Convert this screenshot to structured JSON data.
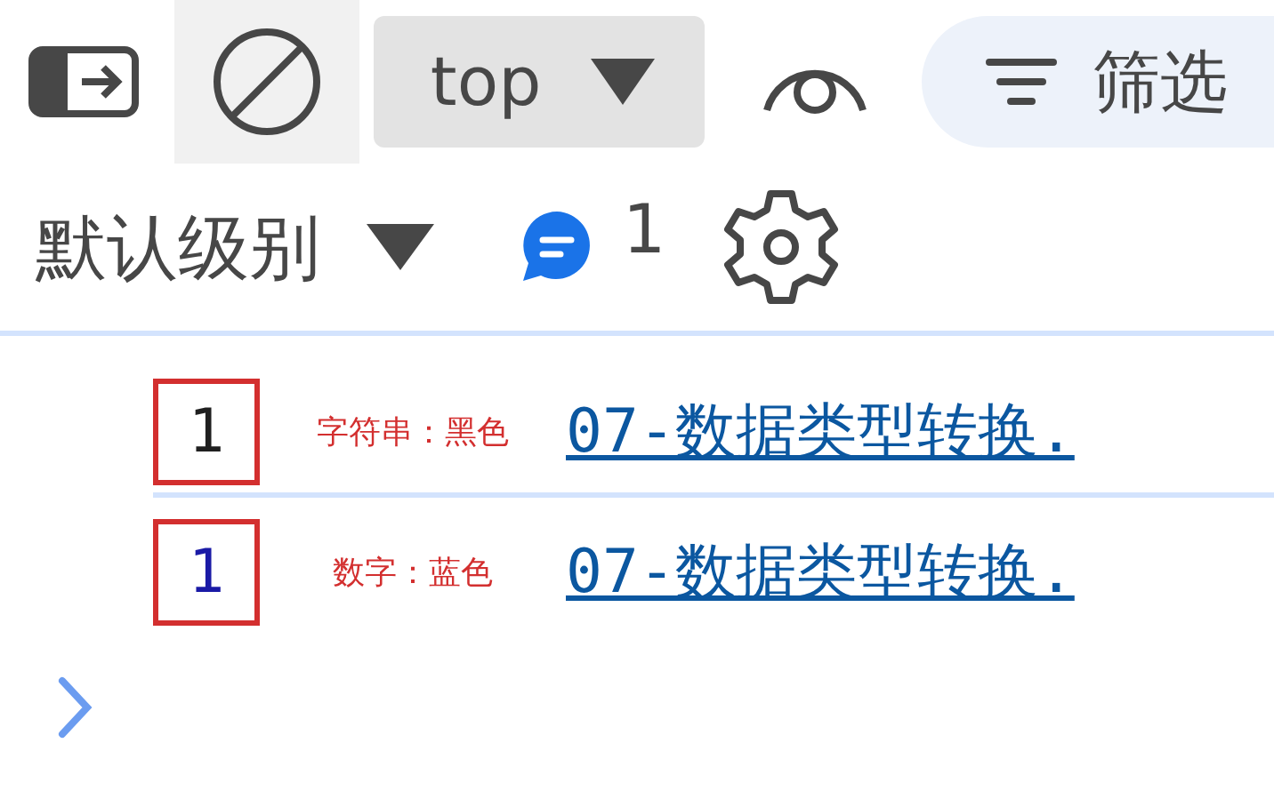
{
  "toolbar": {
    "context": "top",
    "filter_placeholder": "筛选",
    "levels": "默认级别",
    "message_count": "1"
  },
  "rows": [
    {
      "kind": "string",
      "value": "1",
      "annotation": "字符串：黑色",
      "source": "07-数据类型转换."
    },
    {
      "kind": "number",
      "value": "1",
      "annotation": "数字：蓝色",
      "source": "07-数据类型转换."
    }
  ]
}
